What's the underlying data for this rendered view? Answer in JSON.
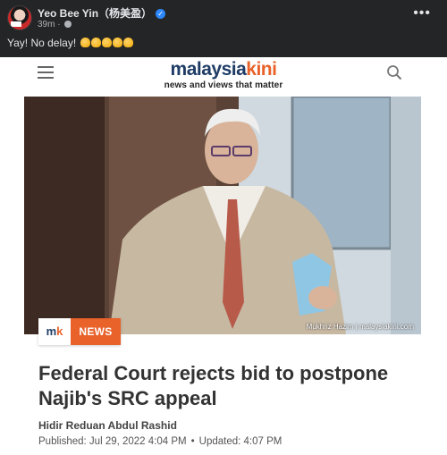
{
  "post": {
    "author": "Yeo Bee Yin（杨美盈）",
    "time": "39m",
    "text": "Yay! No delay!",
    "emoji_icons": [
      "clapping-hands-icon",
      "clapping-hands-icon",
      "clapping-hands-icon",
      "clapping-hands-icon",
      "clapping-hands-icon"
    ]
  },
  "card": {
    "logo": {
      "part1": "malaysia",
      "part2": "kini",
      "tagline": "news and views that matter"
    },
    "photo_credit": "Mukhriz Hazim | malaysiakini.com",
    "badge": {
      "mark_a": "m",
      "mark_b": "k",
      "label": "NEWS"
    },
    "headline": "Federal Court rejects bid to postpone Najib's SRC appeal",
    "byline": "Hidir Reduan Abdul Rashid",
    "published_label": "Published:",
    "published": "Jul 29, 2022 4:04 PM",
    "separator": "•",
    "updated_label": "Updated:",
    "updated": "4:07 PM"
  },
  "colors": {
    "brand_blue": "#1f3c66",
    "brand_orange": "#e8622a",
    "fb_dark": "#242526",
    "verified": "#2d88ff"
  }
}
